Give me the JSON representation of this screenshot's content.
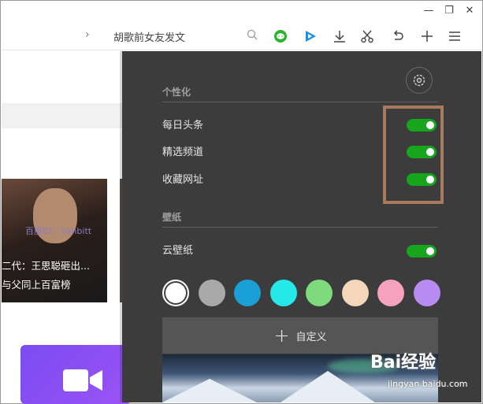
{
  "toolbar": {
    "search_text": "胡歌前女友发文"
  },
  "page": {
    "news_caption_line1": "二代：王思聪砸出...",
    "news_caption_line2": "与父同上百富榜",
    "watermark": "百度ID：Sanbitt"
  },
  "settings": {
    "section_personalize": "个性化",
    "toggles": [
      {
        "label": "每日头条",
        "on": true
      },
      {
        "label": "精选频道",
        "on": true
      },
      {
        "label": "收藏网址",
        "on": true
      }
    ],
    "section_wallpaper": "壁纸",
    "cloud_wallpaper": {
      "label": "云壁纸",
      "on": true
    },
    "swatch_colors": [
      "#ffffff",
      "#a9a9a9",
      "#1a9fd6",
      "#26e8e8",
      "#7ddb7d",
      "#f3d7b8",
      "#f7a3bf",
      "#b88bf0"
    ],
    "selected_swatch": 0,
    "custom_label": "自定义"
  },
  "watermark": {
    "brand": "Bai经验",
    "url": "jingyan.baidu.com"
  },
  "colors": {
    "panel_bg": "#3c3c3c",
    "toggle_on": "#16a51d",
    "highlight_box": "#a8795e",
    "accent_purple": "#8b4ff2"
  }
}
